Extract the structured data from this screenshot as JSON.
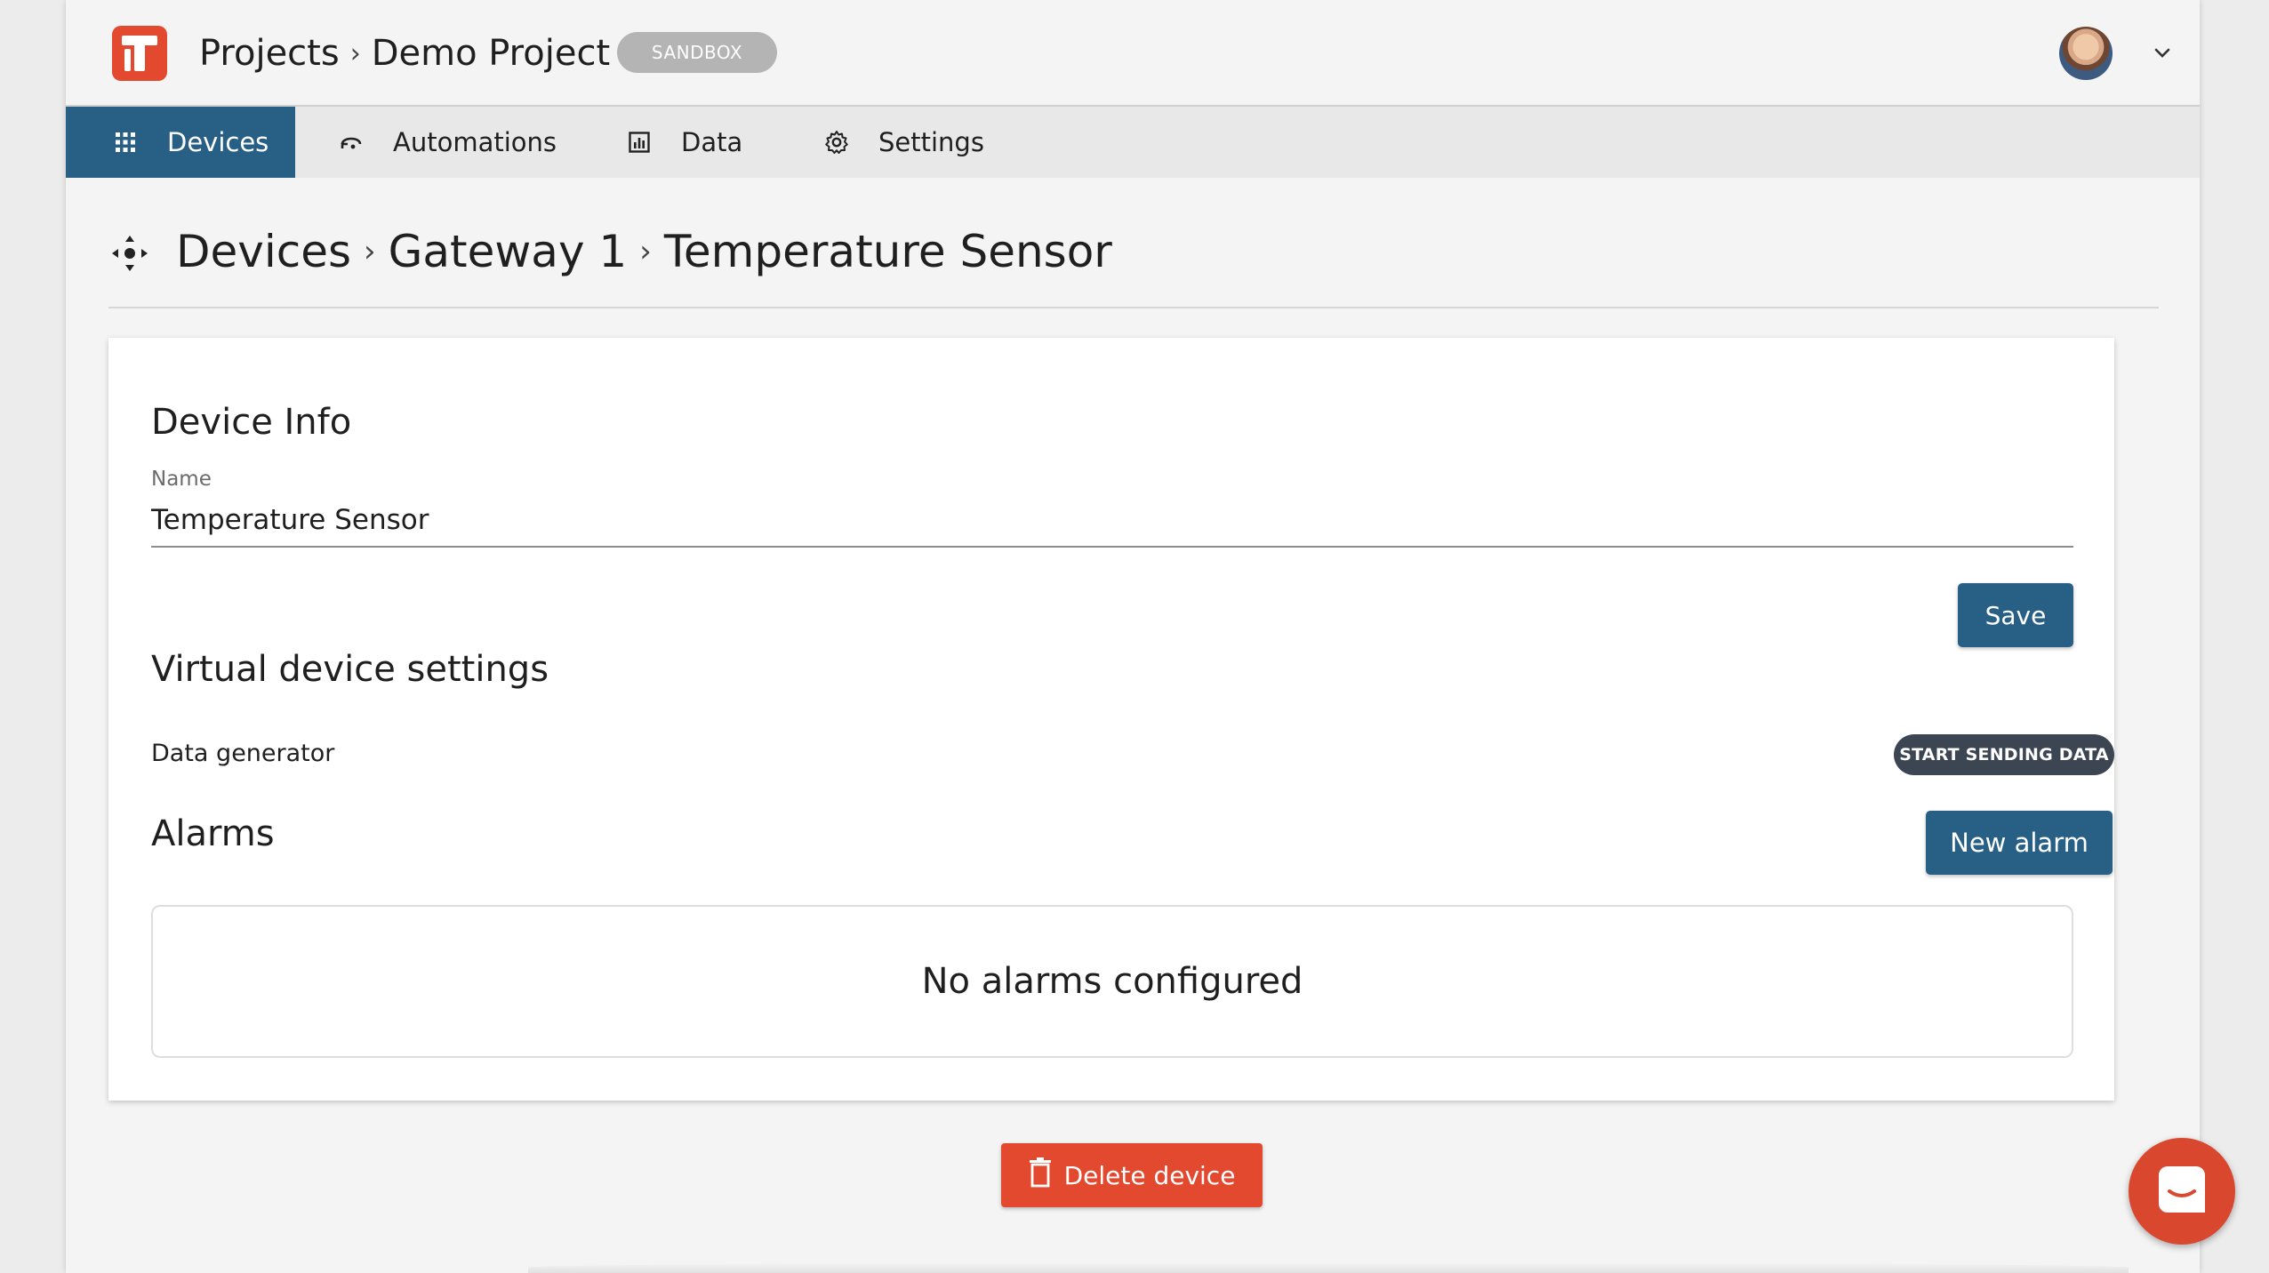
{
  "app": {
    "breadcrumb": [
      "Projects",
      "Demo Project"
    ],
    "env_badge": "SANDBOX",
    "brand_color": "#e3492f",
    "accent_color": "#285f85"
  },
  "nav": {
    "items": [
      {
        "label": "Devices",
        "icon": "grid-icon",
        "active": true
      },
      {
        "label": "Automations",
        "icon": "automations-icon",
        "active": false
      },
      {
        "label": "Data",
        "icon": "chart-icon",
        "active": false
      },
      {
        "label": "Settings",
        "icon": "gear-icon",
        "active": false
      }
    ]
  },
  "page": {
    "breadcrumb": [
      "Devices",
      "Gateway 1",
      "Temperature Sensor"
    ]
  },
  "device_info": {
    "heading": "Device Info",
    "name_label": "Name",
    "name_value": "Temperature Sensor",
    "save_label": "Save"
  },
  "virtual_settings": {
    "heading": "Virtual device settings",
    "data_generator_label": "Data generator",
    "start_button": "START SENDING DATA"
  },
  "alarms": {
    "heading": "Alarms",
    "new_button": "New alarm",
    "empty_text": "No alarms configured"
  },
  "actions": {
    "delete_label": "Delete device"
  }
}
